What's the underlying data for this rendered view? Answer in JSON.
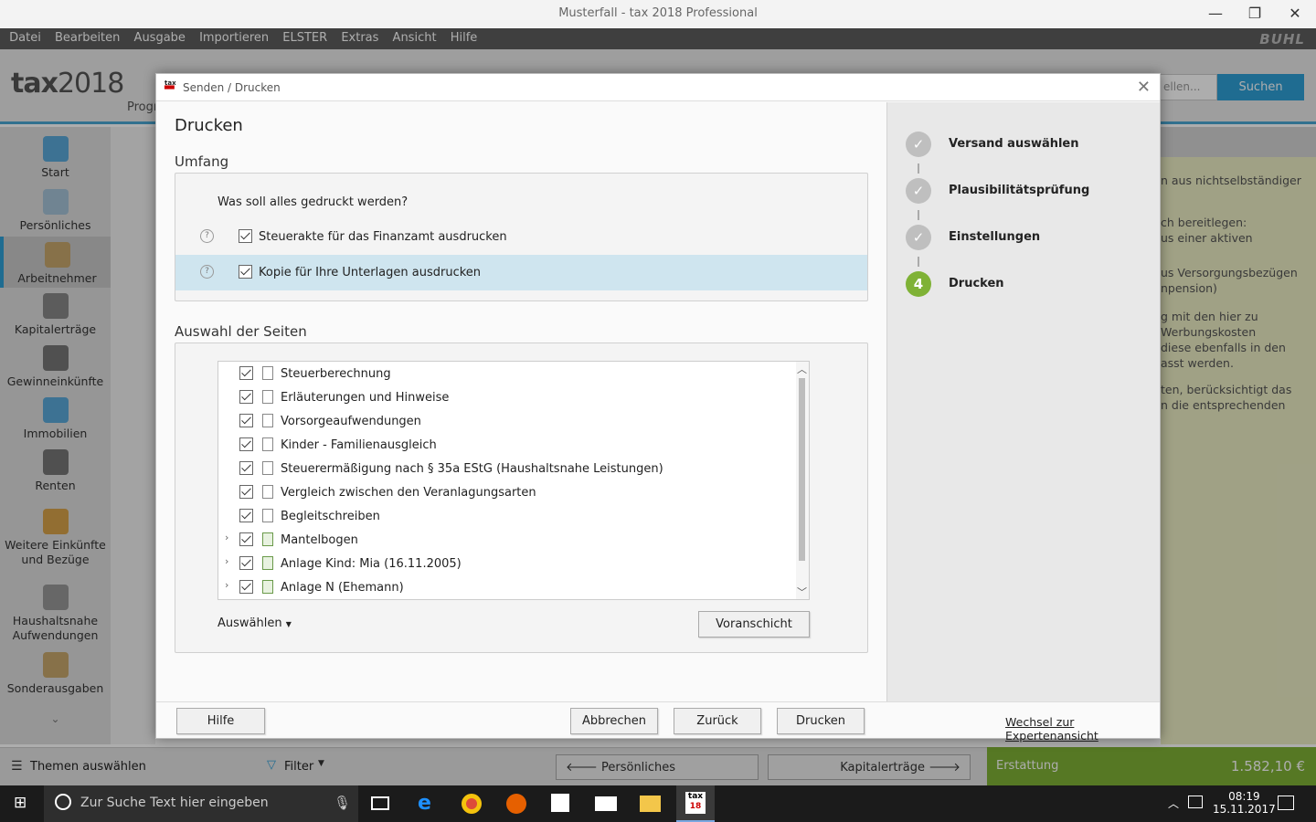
{
  "window": {
    "title": "Musterfall - tax 2018 Professional"
  },
  "menu": {
    "items": [
      "Datei",
      "Bearbeiten",
      "Ausgabe",
      "Importieren",
      "ELSTER",
      "Extras",
      "Ansicht",
      "Hilfe"
    ],
    "brand": "BUHL"
  },
  "app": {
    "logo_tax": "tax",
    "logo_year": "2018",
    "prog_label": "Progr",
    "search_placeholder": "ellen...",
    "search_button": "Suchen"
  },
  "sidebar": {
    "items": [
      "Start",
      "Persönliches",
      "Arbeitnehmer",
      "Kapitalerträge",
      "Gewinneinkünfte",
      "Immobilien",
      "Renten",
      "Weitere Einkünfte und Bezüge",
      "Haushaltsnahe Aufwendungen",
      "Sonderausgaben"
    ]
  },
  "info_panel": {
    "lines": [
      "n aus nichtselbständiger",
      "ch bereitlegen:",
      "us einer aktiven",
      "us Versorgungsbezügen",
      "npension)",
      "g mit den hier zu",
      "Werbungskosten",
      " diese ebenfalls in den",
      "asst werden.",
      "ten, berücksichtigt das",
      "n die entsprechenden"
    ]
  },
  "bottom": {
    "themes": "Themen auswählen",
    "filter": "Filter",
    "prev": "Persönliches",
    "next": "Kapitalerträge",
    "refund_label": "Erstattung",
    "refund_value": "1.582,10 €"
  },
  "taskbar": {
    "search_placeholder": "Zur Suche Text hier eingeben",
    "time": "08:19",
    "date": "15.11.2017"
  },
  "dialog": {
    "title": "Senden / Drucken",
    "heading": "Drucken",
    "scope_heading": "Umfang",
    "scope_question": "Was soll alles gedruckt werden?",
    "scope_options": [
      "Steuerakte für das Finanzamt ausdrucken",
      "Kopie für Ihre Unterlagen ausdrucken"
    ],
    "pages_heading": "Auswahl der Seiten",
    "pages": [
      "Steuerberechnung",
      "Erläuterungen und Hinweise",
      "Vorsorgeaufwendungen",
      "Kinder - Familienausgleich",
      "Steuerermäßigung nach § 35a EStG (Haushaltsnahe Leistungen)",
      "Vergleich zwischen den Veranlagungsarten",
      "Begleitschreiben",
      "Mantelbogen",
      "Anlage Kind: Mia (16.11.2005)",
      "Anlage N (Ehemann)"
    ],
    "select_label": "Auswählen",
    "preview_button": "Voranschicht",
    "steps": [
      "Versand auswählen",
      "Plausibilitätsprüfung",
      "Einstellungen",
      "Drucken"
    ],
    "current_step_number": "4",
    "buttons": {
      "help": "Hilfe",
      "cancel": "Abbrechen",
      "back": "Zurück",
      "print": "Drucken"
    },
    "expert_link": "Wechsel zur Expertenansicht"
  }
}
